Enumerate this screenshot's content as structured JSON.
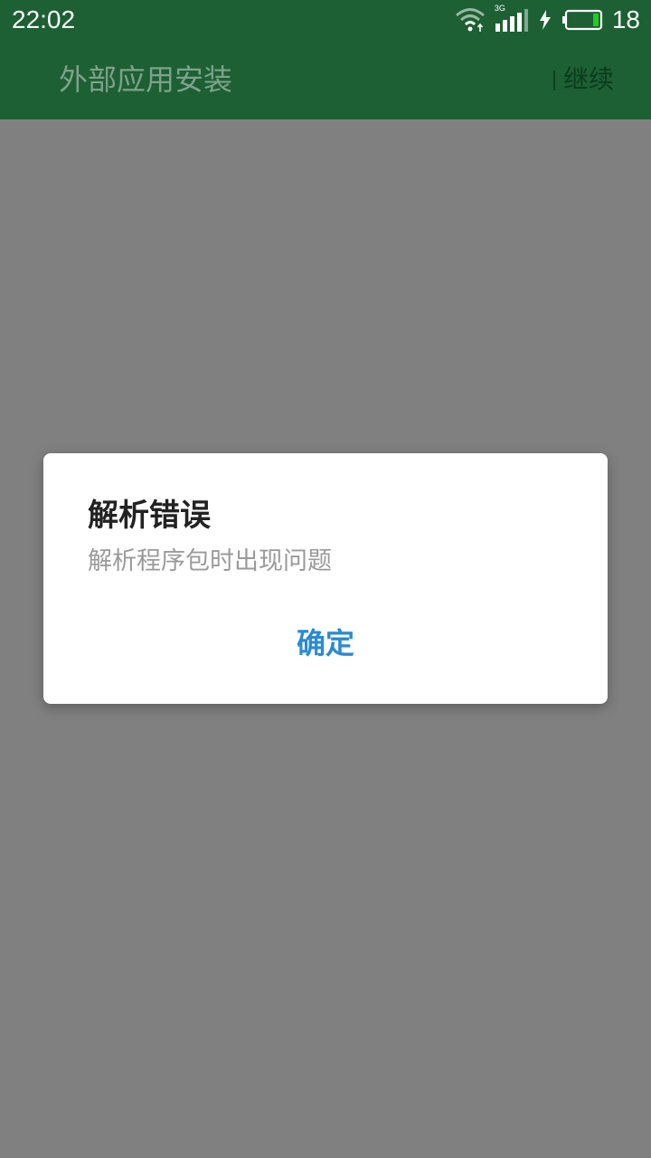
{
  "status_bar": {
    "time": "22:02",
    "network_type": "3G",
    "battery_percent": "18",
    "battery_level": 0.18,
    "icons": [
      "wifi-icon",
      "cellular-signal-icon",
      "charging-bolt-icon",
      "battery-icon"
    ]
  },
  "app_bar": {
    "title": "外部应用安装",
    "action_label": "继续"
  },
  "dialog": {
    "title": "解析错误",
    "message": "解析程序包时出现问题",
    "confirm_label": "确定"
  },
  "colors": {
    "status_bar_bg": "#1c6033",
    "scrim": "#808080",
    "dialog_bg": "#ffffff",
    "button_text": "#2a8ad4",
    "battery_fill": "#22cc22"
  }
}
